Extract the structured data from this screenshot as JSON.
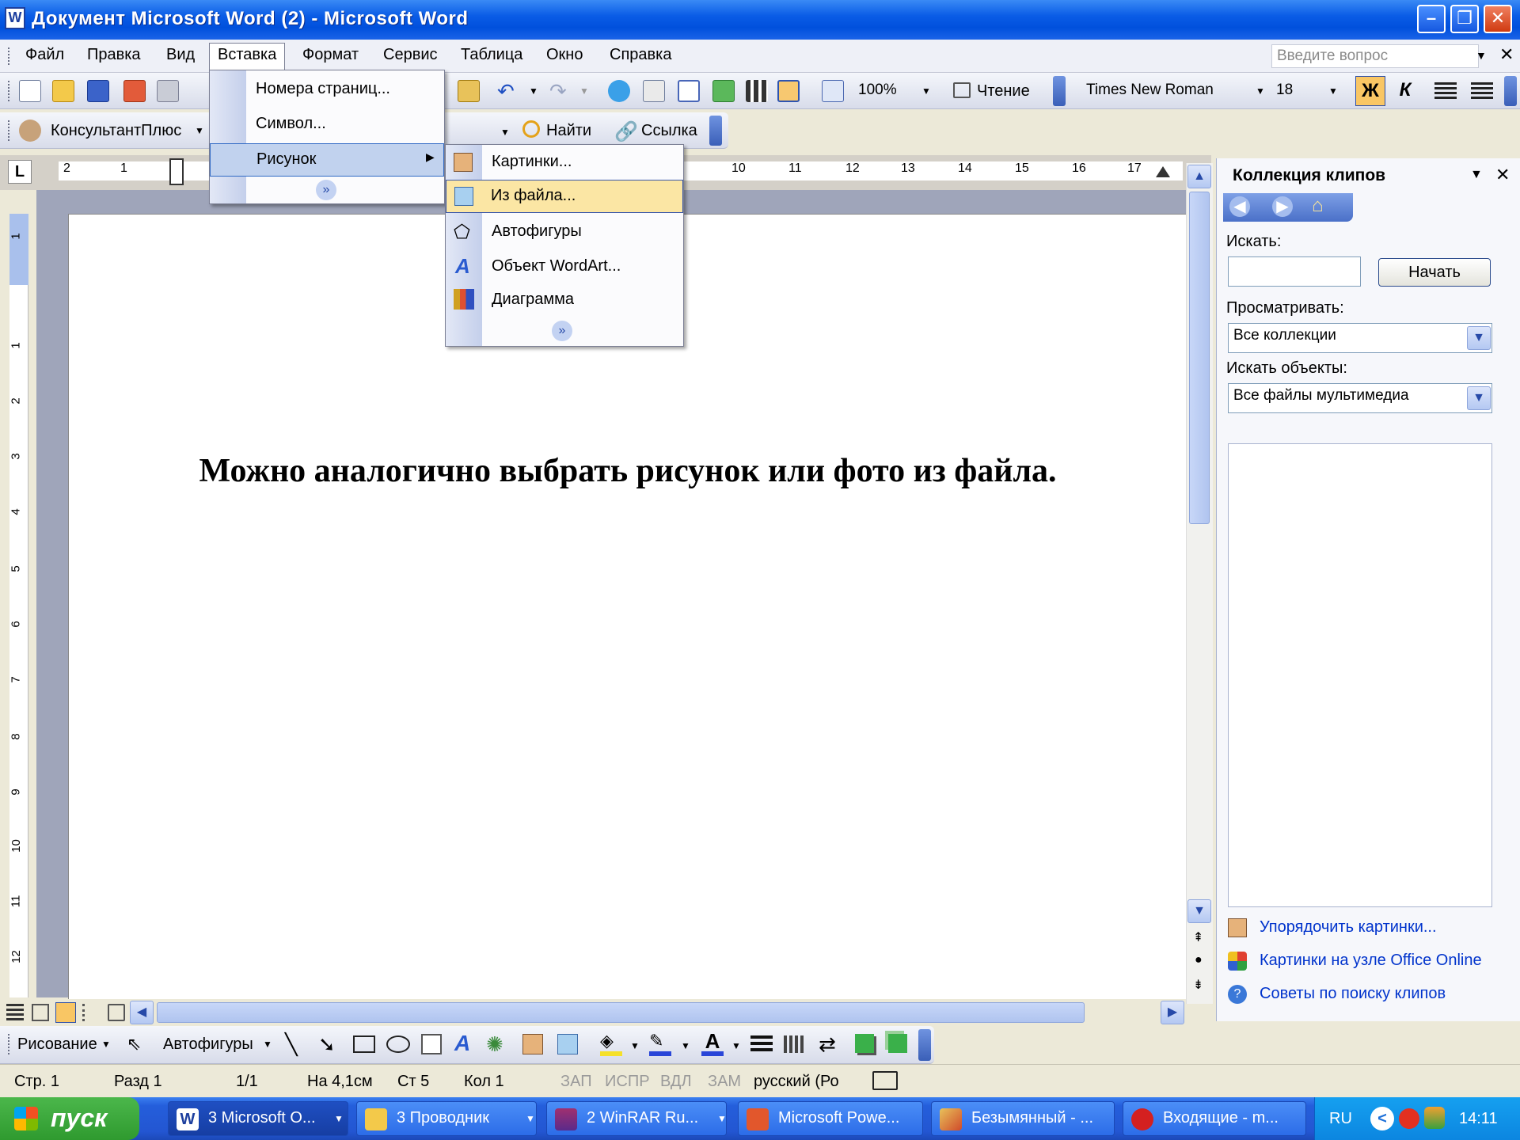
{
  "window": {
    "title": "Документ Microsoft Word (2) - Microsoft Word"
  },
  "menubar": {
    "items": [
      "Файл",
      "Правка",
      "Вид",
      "Вставка",
      "Формат",
      "Сервис",
      "Таблица",
      "Окно",
      "Справка"
    ],
    "active": "Вставка",
    "help_placeholder": "Введите вопрос"
  },
  "toolbar": {
    "zoom": "100%",
    "reading_label": "Чтение",
    "font": "Times New Roman",
    "size": "18",
    "bold": "Ж",
    "italic": "К"
  },
  "toolbar2": {
    "konsultant": "КонсультантПлюс",
    "find": "Найти",
    "link": "Ссылка"
  },
  "insert_menu": {
    "items": [
      "Номера страниц...",
      "Символ...",
      "Рисунок"
    ],
    "highlighted": "Рисунок"
  },
  "picture_submenu": {
    "items": [
      "Картинки...",
      "Из файла...",
      "Автофигуры",
      "Объект WordArt...",
      "Диаграмма"
    ],
    "highlighted": "Из файла..."
  },
  "ruler": {
    "left_marks": [
      "2",
      "1"
    ],
    "right_marks": [
      "10",
      "11",
      "12",
      "13",
      "14",
      "15",
      "16",
      "17"
    ],
    "vertical_marks": [
      "1",
      "1",
      "2",
      "3",
      "4",
      "5",
      "6",
      "7",
      "8",
      "9",
      "10",
      "11",
      "12"
    ]
  },
  "document": {
    "text": "Можно аналогично выбрать рисунок или фото из файла."
  },
  "taskpane": {
    "title": "Коллекция клипов",
    "search_label": "Искать:",
    "search_value": "",
    "start_button": "Начать",
    "browse_label": "Просматривать:",
    "browse_value": "Все коллекции",
    "find_objects_label": "Искать объекты:",
    "find_objects_value": "Все файлы мультимедиа",
    "links": [
      "Упорядочить картинки...",
      "Картинки на узле Office Online",
      "Советы по поиску клипов"
    ]
  },
  "drawing_toolbar": {
    "draw": "Рисование",
    "autoshapes": "Автофигуры"
  },
  "statusbar": {
    "page": "Стр. 1",
    "section": "Разд 1",
    "pages": "1/1",
    "at": "На 4,1см",
    "line": "Ст 5",
    "col": "Кол 1",
    "rec": "ЗАП",
    "trk": "ИСПР",
    "ext": "ВДЛ",
    "ovr": "ЗАМ",
    "lang": "русский (Ро"
  },
  "taskbar": {
    "start": "пуск",
    "tasks": [
      "3 Microsoft O...",
      "3 Проводник",
      "2 WinRAR Ru...",
      "Microsoft Powe...",
      "Безымянный - ...",
      "Входящие - m..."
    ],
    "lang": "RU",
    "clock": "14:11"
  }
}
